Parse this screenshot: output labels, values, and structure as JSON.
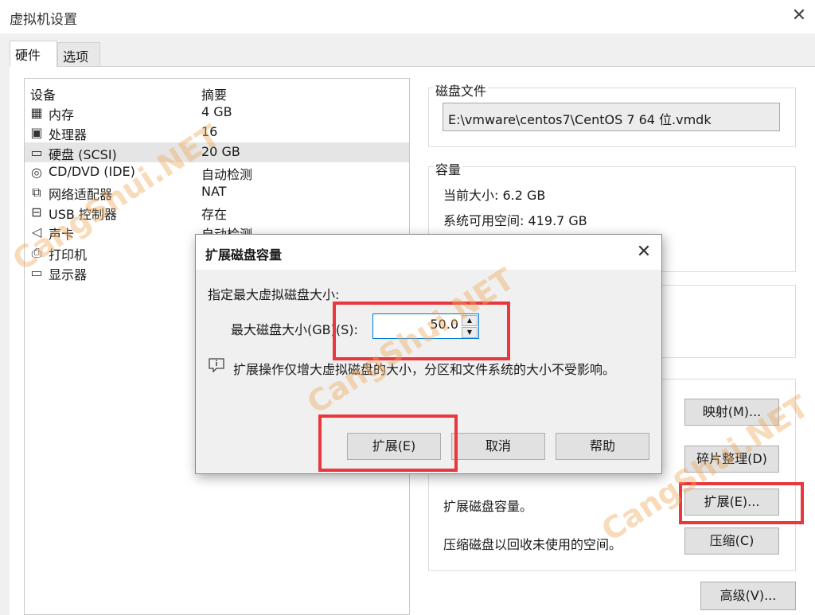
{
  "window": {
    "title": "虚拟机设置",
    "close_glyph": "✕"
  },
  "tabs": [
    {
      "label": "硬件"
    },
    {
      "label": "选项"
    }
  ],
  "device_list": {
    "header_device": "设备",
    "header_summary": "摘要",
    "items": [
      {
        "icon": "memory-icon",
        "name": "内存",
        "summary": "4 GB"
      },
      {
        "icon": "cpu-icon",
        "name": "处理器",
        "summary": "16"
      },
      {
        "icon": "harddisk-icon",
        "name": "硬盘 (SCSI)",
        "summary": "20 GB"
      },
      {
        "icon": "cdrom-icon",
        "name": "CD/DVD (IDE)",
        "summary": "自动检测"
      },
      {
        "icon": "network-icon",
        "name": "网络适配器",
        "summary": "NAT"
      },
      {
        "icon": "usb-icon",
        "name": "USB 控制器",
        "summary": "存在"
      },
      {
        "icon": "sound-icon",
        "name": "声卡",
        "summary": "自动检测"
      },
      {
        "icon": "printer-icon",
        "name": "打印机",
        "summary": ""
      },
      {
        "icon": "monitor-icon",
        "name": "显示器",
        "summary": ""
      }
    ]
  },
  "disk_file": {
    "title": "磁盘文件",
    "path": "E:\\vmware\\centos7\\CentOS 7 64 位.vmdk"
  },
  "capacity": {
    "title": "容量",
    "current_size": "当前大小: 6.2 GB",
    "system_free": "系统可用空间: 419.7 GB"
  },
  "utilities": {
    "map_button": "映射(M)...",
    "defrag_button": "碎片整理(D)",
    "expand_label": "扩展磁盘容量。",
    "expand_button": "扩展(E)...",
    "compact_label": "压缩磁盘以回收未使用的空间。",
    "compact_button": "压缩(C)"
  },
  "advanced_button": "高级(V)...",
  "dialog": {
    "title": "扩展磁盘容量",
    "close_glyph": "✕",
    "prompt": "指定最大虚拟磁盘大小:",
    "size_label": "最大磁盘大小(GB)(S):",
    "size_value": "50.0",
    "info_text": "扩展操作仅增大虚拟磁盘的大小，分区和文件系统的大小不受影响。",
    "expand_button": "扩展(E)",
    "cancel_button": "取消",
    "help_button": "帮助"
  },
  "watermark": "CangShui.NET",
  "colors": {
    "highlight": "#e8373d",
    "selection": "#e5e5e5",
    "focus": "#0078d7"
  }
}
